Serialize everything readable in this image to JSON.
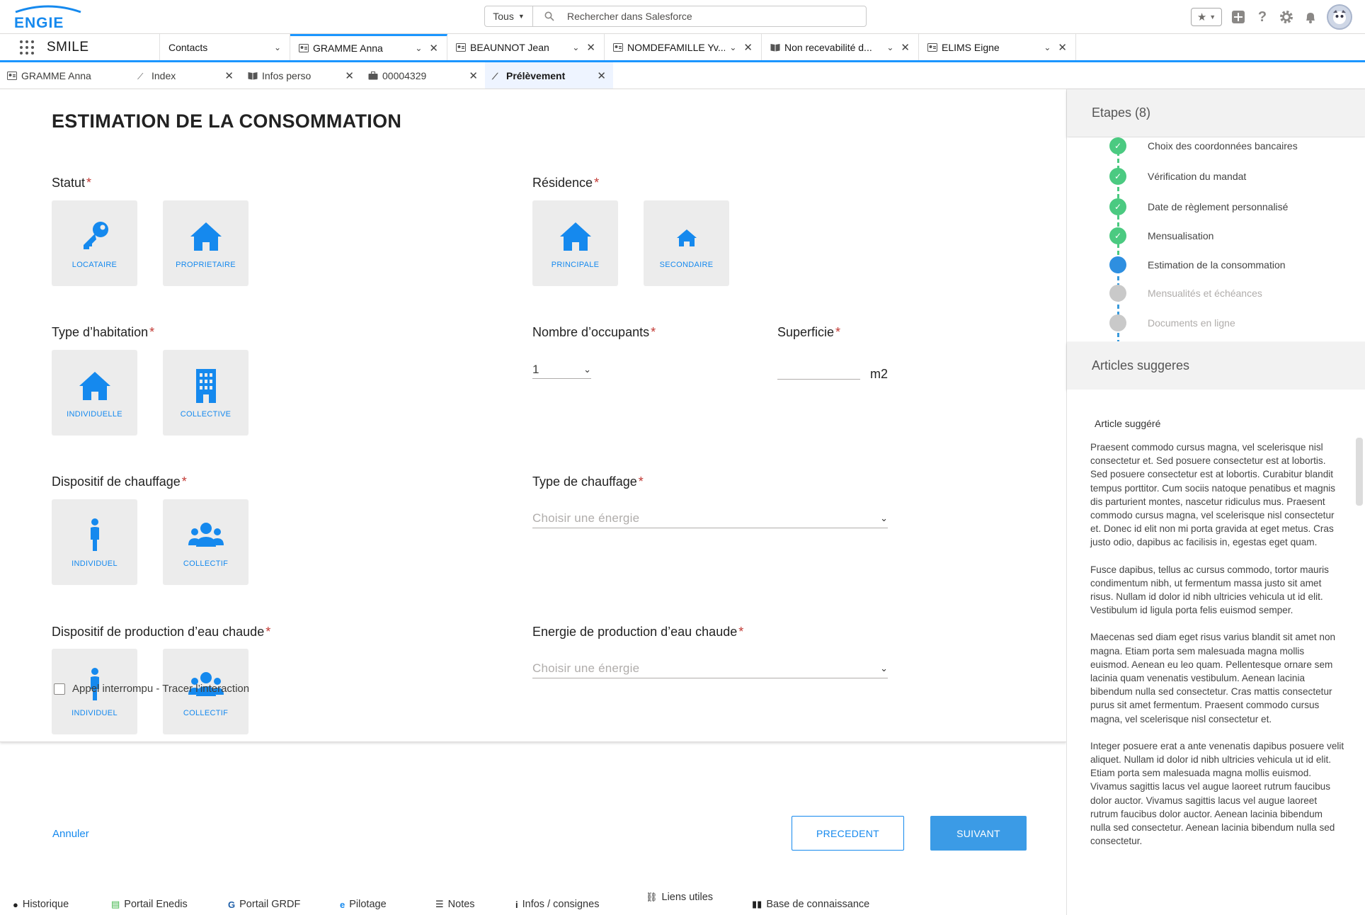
{
  "brand": {
    "logo_text": "ENGIE",
    "accent": "#1589ee",
    "tile_bg": "#ececec"
  },
  "search": {
    "scope": "Tous",
    "placeholder": "Rechercher dans Salesforce"
  },
  "app": {
    "name": "SMILE"
  },
  "nav_tabs": [
    {
      "label": "Contacts",
      "icon": "none"
    },
    {
      "label": "GRAMME Anna",
      "icon": "contact-card-icon"
    },
    {
      "label": "BEAUNNOT Jean",
      "icon": "contact-card-icon"
    },
    {
      "label": "NOMDEFAMILLE Yv...",
      "icon": "contact-card-icon"
    },
    {
      "label": "Non recevabilité d...",
      "icon": "book-icon"
    },
    {
      "label": "ELIMS Eigne",
      "icon": "contact-card-icon"
    }
  ],
  "sub_tabs": [
    {
      "label": "GRAMME Anna",
      "icon": "contact-card-icon"
    },
    {
      "label": "Index",
      "icon": "wand-icon"
    },
    {
      "label": "Infos perso",
      "icon": "book-icon"
    },
    {
      "label": "00004329",
      "icon": "briefcase-icon"
    },
    {
      "label": "Prélèvement",
      "icon": "wand-icon"
    }
  ],
  "form": {
    "title": "ESTIMATION DE LA CONSOMMATION",
    "statut": {
      "label": "Statut",
      "options": [
        "LOCATAIRE",
        "PROPRIETAIRE"
      ]
    },
    "residence": {
      "label": "Résidence",
      "options": [
        "PRINCIPALE",
        "SECONDAIRE"
      ]
    },
    "type_habitation": {
      "label": "Type d’habitation",
      "options": [
        "INDIVIDUELLE",
        "COLLECTIVE"
      ]
    },
    "occupants": {
      "label": "Nombre d’occupants",
      "value": "1"
    },
    "superficie": {
      "label": "Superficie",
      "value": "",
      "unit": "m2"
    },
    "dispositif_chauffage": {
      "label": "Dispositif de chauffage",
      "options": [
        "INDIVIDUEL",
        "COLLECTIF"
      ]
    },
    "type_chauffage": {
      "label": "Type de chauffage",
      "placeholder": "Choisir une énergie"
    },
    "dispositif_eau": {
      "label": "Dispositif de production d’eau chaude",
      "options": [
        "INDIVIDUEL",
        "COLLECTIF"
      ]
    },
    "energie_eau": {
      "label": "Energie de production d’eau chaude",
      "placeholder": "Choisir une énergie"
    },
    "checkbox_label": "Appel interrompu - Tracer l’interaction",
    "cancel": "Annuler",
    "prev": "PRECEDENT",
    "next": "SUIVANT"
  },
  "steps": {
    "title": "Etapes (8)",
    "items": [
      {
        "label": "Choix des coordonnées bancaires",
        "status": "done"
      },
      {
        "label": "Vérification du mandat",
        "status": "done"
      },
      {
        "label": "Date de règlement personnalisé",
        "status": "done"
      },
      {
        "label": "Mensualisation",
        "status": "done"
      },
      {
        "label": "Estimation de la consommation",
        "status": "current"
      },
      {
        "label": "Mensualités et échéances",
        "status": "todo"
      },
      {
        "label": "Documents en ligne",
        "status": "todo"
      }
    ]
  },
  "articles": {
    "title": "Articles suggeres",
    "article_title": "Article suggéré",
    "paragraphs": [
      "Praesent commodo cursus magna, vel scelerisque nisl consectetur et. Sed posuere consectetur est at lobortis. Sed posuere consectetur est at lobortis. Curabitur blandit tempus porttitor. Cum sociis natoque penatibus et magnis dis parturient montes, nascetur ridiculus mus. Praesent commodo cursus magna, vel scelerisque nisl consectetur et. Donec id elit non mi porta gravida at eget metus. Cras justo odio, dapibus ac facilisis in, egestas eget quam.",
      "Fusce dapibus, tellus ac cursus commodo, tortor mauris condimentum nibh, ut fermentum massa justo sit amet risus. Nullam id dolor id nibh ultricies vehicula ut id elit. Vestibulum id ligula porta felis euismod semper.",
      "Maecenas sed diam eget risus varius blandit sit amet non magna. Etiam porta sem malesuada magna mollis euismod. Aenean eu leo quam. Pellentesque ornare sem lacinia quam venenatis vestibulum. Aenean lacinia bibendum nulla sed consectetur. Cras mattis consectetur purus sit amet fermentum. Praesent commodo cursus magna, vel scelerisque nisl consectetur et.",
      "Integer posuere erat a ante venenatis dapibus posuere velit aliquet. Nullam id dolor id nibh ultricies vehicula ut id elit. Etiam porta sem malesuada magna mollis euismod. Vivamus sagittis lacus vel augue laoreet rutrum faucibus dolor auctor. Vivamus sagittis lacus vel augue laoreet rutrum faucibus dolor auctor. Aenean lacinia bibendum nulla sed consectetur. Aenean lacinia bibendum nulla sed consectetur."
    ]
  },
  "utility": [
    {
      "label": "Historique",
      "icon": "clock-icon"
    },
    {
      "label": "Portail Enedis",
      "icon": "enedis-icon"
    },
    {
      "label": "Portail GRDF",
      "icon": "grdf-icon"
    },
    {
      "label": "Pilotage",
      "icon": "pilotage-icon"
    },
    {
      "label": "Notes",
      "icon": "notes-icon"
    },
    {
      "label": "Infos / consignes",
      "icon": "info-icon"
    },
    {
      "label": "Liens utiles",
      "icon": "link-icon"
    },
    {
      "label": "Base de connaissance",
      "icon": "book-icon"
    }
  ]
}
